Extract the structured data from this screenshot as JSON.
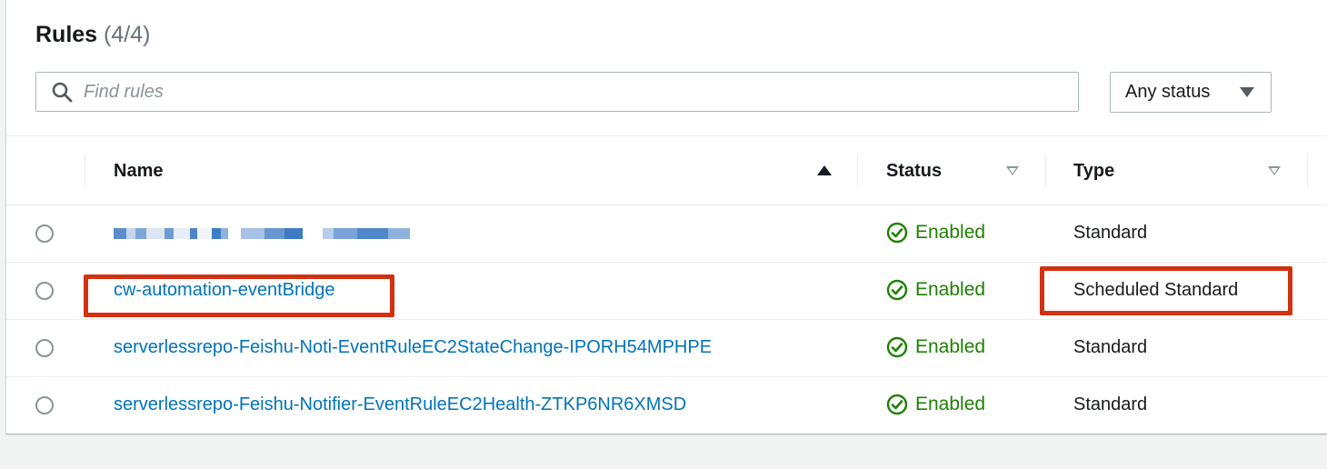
{
  "header": {
    "title": "Rules",
    "count": "(4/4)"
  },
  "search": {
    "placeholder": "Find rules"
  },
  "filter": {
    "selected": "Any status"
  },
  "columns": {
    "name": "Name",
    "status": "Status",
    "type": "Type"
  },
  "rows": [
    {
      "name": "",
      "redacted": true,
      "status": "Enabled",
      "type": "Standard"
    },
    {
      "name": "cw-automation-eventBridge",
      "status": "Enabled",
      "type": "Scheduled Standard"
    },
    {
      "name": "serverlessrepo-Feishu-Noti-EventRuleEC2StateChange-IPORH54MPHPE",
      "status": "Enabled",
      "type": "Standard"
    },
    {
      "name": "serverlessrepo-Feishu-Notifier-EventRuleEC2Health-ZTKP6NR6XMSD",
      "status": "Enabled",
      "type": "Standard"
    }
  ],
  "colors": {
    "link": "#0073bb",
    "success": "#1d8102",
    "highlight": "#d13212"
  }
}
